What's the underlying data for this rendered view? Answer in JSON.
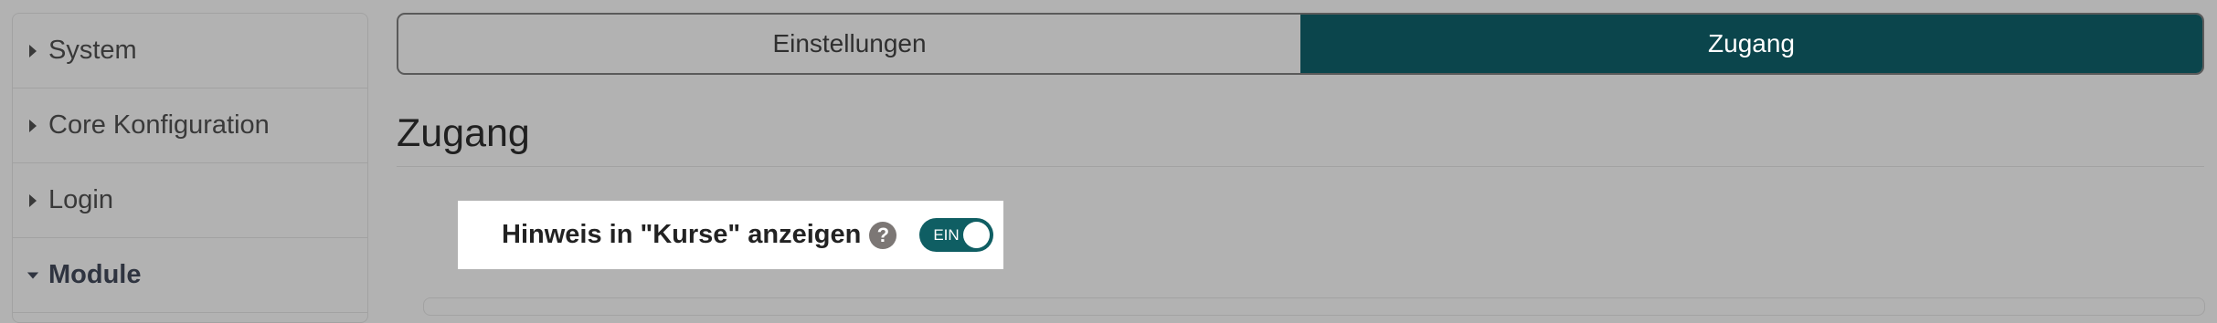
{
  "sidebar": {
    "items": [
      {
        "label": "System",
        "icon": "caret-right-icon",
        "active": false
      },
      {
        "label": "Core Konfiguration",
        "icon": "caret-right-icon",
        "active": false
      },
      {
        "label": "Login",
        "icon": "caret-right-icon",
        "active": false
      },
      {
        "label": "Module",
        "icon": "caret-down-icon",
        "active": true
      }
    ]
  },
  "tabs": [
    {
      "label": "Einstellungen",
      "active": false
    },
    {
      "label": "Zugang",
      "active": true
    }
  ],
  "main": {
    "heading": "Zugang",
    "setting": {
      "label": "Hinweis in \"Kurse\" anzeigen",
      "help_glyph": "?",
      "toggle_text": "EIN",
      "toggle_on": true
    }
  },
  "colors": {
    "accent": "#0b454c",
    "toggle": "#0f5e63",
    "background": "#b2b2b2"
  }
}
